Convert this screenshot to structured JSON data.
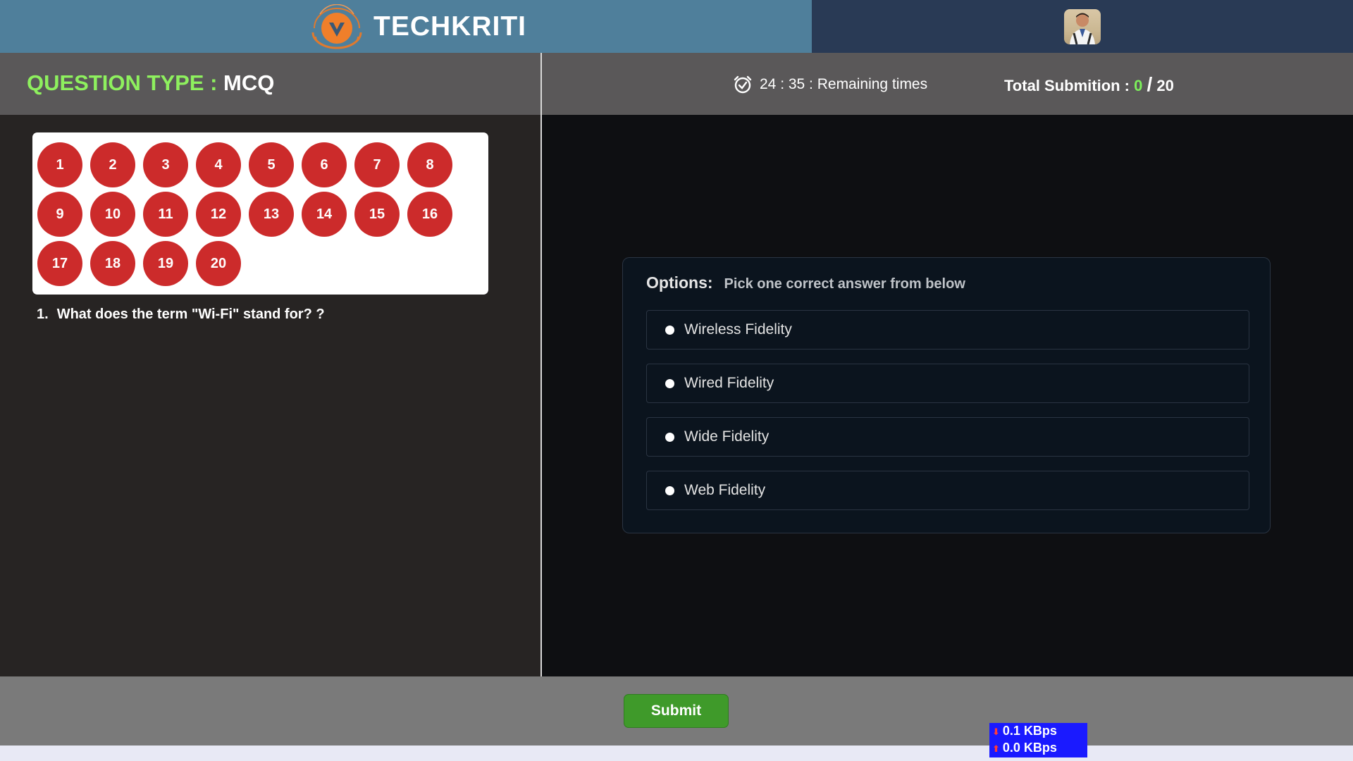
{
  "header": {
    "brand_name": "TECHKRITI",
    "logo_icon": "techkriti-logo-icon",
    "avatar_icon": "user-avatar-icon"
  },
  "question_type": {
    "label": "QUESTION TYPE :",
    "value": "MCQ"
  },
  "timer": {
    "text": "24 : 35 : Remaining times",
    "icon": "alarm-clock-icon"
  },
  "submission": {
    "label": "Total Submition :",
    "done": "0",
    "separator": "/",
    "total": "20"
  },
  "question_numbers": [
    "1",
    "2",
    "3",
    "4",
    "5",
    "6",
    "7",
    "8",
    "9",
    "10",
    "11",
    "12",
    "13",
    "14",
    "15",
    "16",
    "17",
    "18",
    "19",
    "20"
  ],
  "question": {
    "number": "1.",
    "text": "What does the term \"Wi-Fi\" stand for? ?"
  },
  "options": {
    "title": "Options:",
    "subtitle": "Pick one correct answer from below",
    "items": [
      "Wireless Fidelity",
      "Wired Fidelity",
      "Wide Fidelity",
      "Web Fidelity"
    ]
  },
  "submit_label": "Submit",
  "network": {
    "down": "0.1 KBps",
    "up": "0.0 KBps"
  },
  "colors": {
    "header_left": "#4f7f9b",
    "header_right": "#293a55",
    "question_badge": "#cc2b2b",
    "accent_green": "#8ef05e",
    "submit_green": "#3f9a2a",
    "network_bg": "#1a1aff"
  }
}
